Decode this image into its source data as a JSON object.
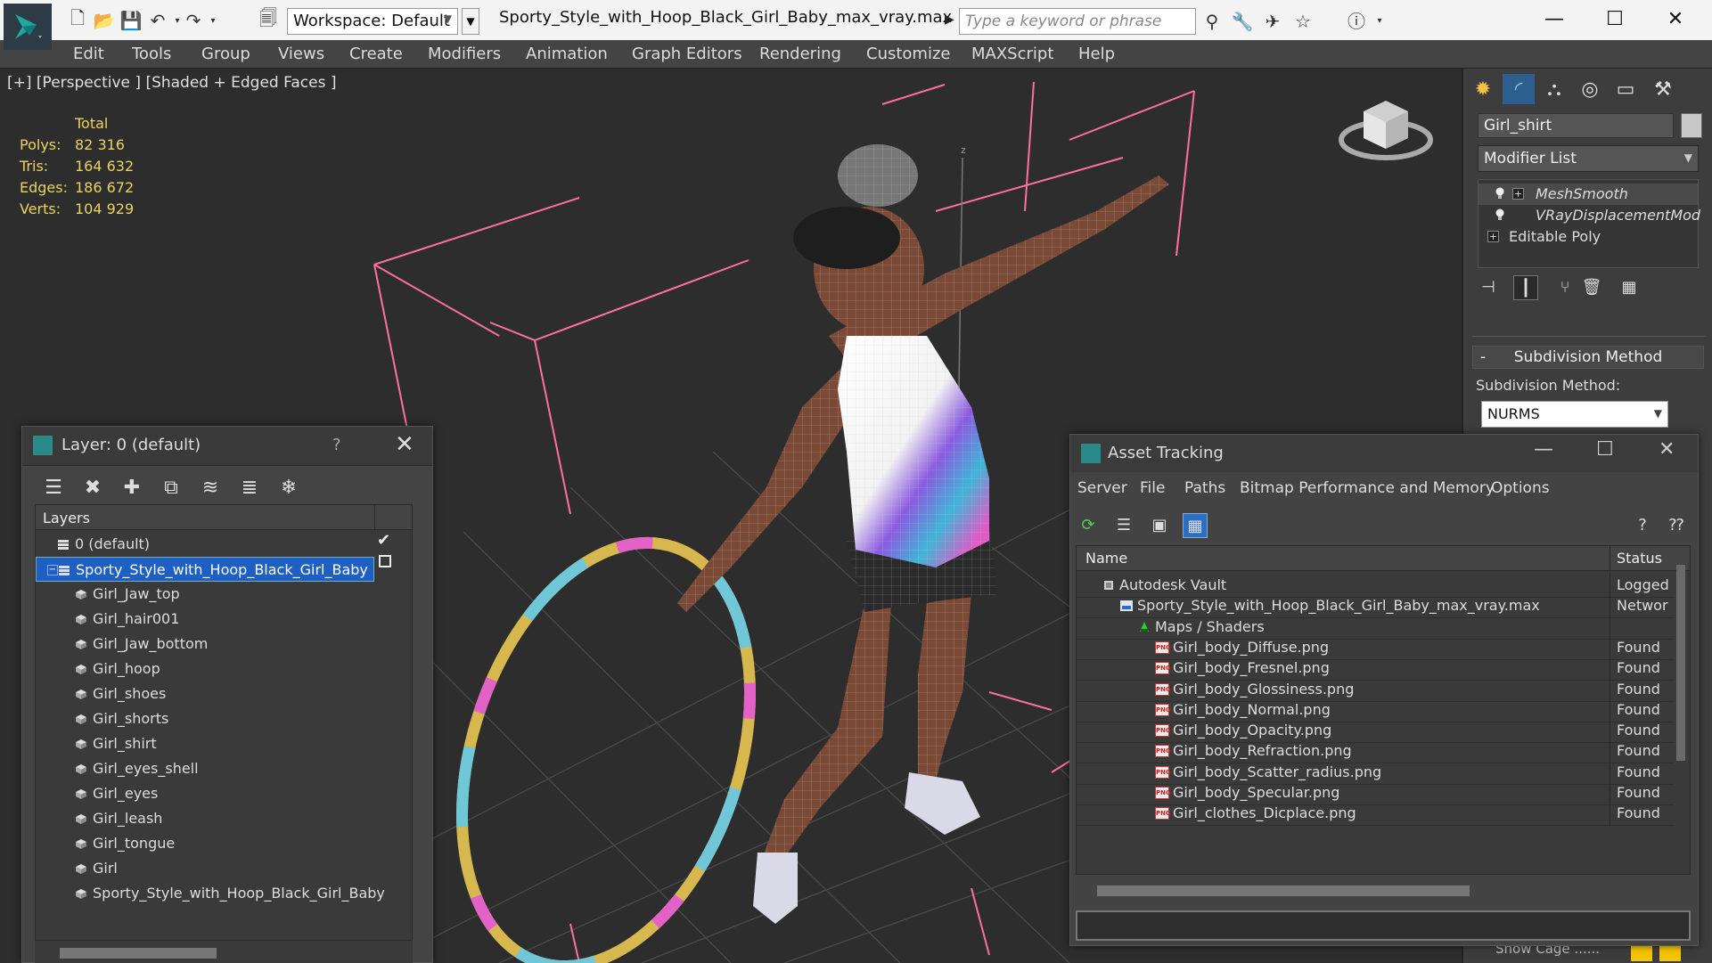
{
  "titlebar": {
    "workspace_label": "Workspace: Default",
    "document_title": "Sporty_Style_with_Hoop_Black_Girl_Baby_max_vray.max",
    "search_placeholder": "Type a keyword or phrase"
  },
  "menu": [
    "Edit",
    "Tools",
    "Group",
    "Views",
    "Create",
    "Modifiers",
    "Animation",
    "Graph Editors",
    "Rendering",
    "Customize",
    "MAXScript",
    "Help"
  ],
  "viewport": {
    "label": "[+] [Perspective ] [Shaded + Edged Faces ]",
    "stats": {
      "header": "Total",
      "rows": [
        {
          "label": "Polys:",
          "value": "82 316"
        },
        {
          "label": "Tris:",
          "value": "164 632"
        },
        {
          "label": "Edges:",
          "value": "186 672"
        },
        {
          "label": "Verts:",
          "value": "104 929"
        }
      ]
    }
  },
  "command_panel": {
    "object_name": "Girl_shirt",
    "modifier_list_label": "Modifier List",
    "stack": [
      "MeshSmooth",
      "VRayDisplacementMod",
      "Editable Poly"
    ],
    "rollout_title": "Subdivision Method",
    "rollout_minus": "-",
    "subdivision_label": "Subdivision Method:",
    "subdivision_value": "NURMS",
    "show_cage_label": "Show Cage ......"
  },
  "layer_window": {
    "title": "Layer: 0 (default)",
    "help": "?",
    "header": "Layers",
    "rows": [
      {
        "label": "0 (default)",
        "level": 0,
        "type": "layer"
      },
      {
        "label": "Sporty_Style_with_Hoop_Black_Girl_Baby",
        "level": 0,
        "type": "layer",
        "selected": true
      },
      {
        "label": "Girl_Jaw_top",
        "level": 1,
        "type": "object"
      },
      {
        "label": "Girl_hair001",
        "level": 1,
        "type": "object"
      },
      {
        "label": "Girl_Jaw_bottom",
        "level": 1,
        "type": "object"
      },
      {
        "label": "Girl_hoop",
        "level": 1,
        "type": "object"
      },
      {
        "label": "Girl_shoes",
        "level": 1,
        "type": "object"
      },
      {
        "label": "Girl_shorts",
        "level": 1,
        "type": "object"
      },
      {
        "label": "Girl_shirt",
        "level": 1,
        "type": "object"
      },
      {
        "label": "Girl_eyes_shell",
        "level": 1,
        "type": "object"
      },
      {
        "label": "Girl_eyes",
        "level": 1,
        "type": "object"
      },
      {
        "label": "Girl_leash",
        "level": 1,
        "type": "object"
      },
      {
        "label": "Girl_tongue",
        "level": 1,
        "type": "object"
      },
      {
        "label": "Girl",
        "level": 1,
        "type": "object"
      },
      {
        "label": "Sporty_Style_with_Hoop_Black_Girl_Baby",
        "level": 1,
        "type": "object"
      }
    ]
  },
  "asset_window": {
    "title": "Asset Tracking",
    "menu": [
      "Server",
      "File",
      "Paths",
      "Bitmap Performance and Memory",
      "Options"
    ],
    "columns": {
      "name": "Name",
      "status": "Status"
    },
    "rows": [
      {
        "name": "Autodesk Vault",
        "status": "Logged",
        "level": 0,
        "icon": "vault"
      },
      {
        "name": "Sporty_Style_with_Hoop_Black_Girl_Baby_max_vray.max",
        "status": "Networ",
        "level": 1,
        "icon": "max"
      },
      {
        "name": "Maps / Shaders",
        "status": "",
        "level": 2,
        "icon": "maps"
      },
      {
        "name": "Girl_body_Diffuse.png",
        "status": "Found",
        "level": 3,
        "icon": "png"
      },
      {
        "name": "Girl_body_Fresnel.png",
        "status": "Found",
        "level": 3,
        "icon": "png"
      },
      {
        "name": "Girl_body_Glossiness.png",
        "status": "Found",
        "level": 3,
        "icon": "png"
      },
      {
        "name": "Girl_body_Normal.png",
        "status": "Found",
        "level": 3,
        "icon": "png"
      },
      {
        "name": "Girl_body_Opacity.png",
        "status": "Found",
        "level": 3,
        "icon": "png"
      },
      {
        "name": "Girl_body_Refraction.png",
        "status": "Found",
        "level": 3,
        "icon": "png"
      },
      {
        "name": "Girl_body_Scatter_radius.png",
        "status": "Found",
        "level": 3,
        "icon": "png"
      },
      {
        "name": "Girl_body_Specular.png",
        "status": "Found",
        "level": 3,
        "icon": "png"
      },
      {
        "name": "Girl_clothes_Dicplace.png",
        "status": "Found",
        "level": 3,
        "icon": "png"
      }
    ]
  },
  "colors": {
    "accent": "#1e5fc4",
    "stats_text": "#e8d560",
    "grid_lines": "#ff6fa0"
  }
}
